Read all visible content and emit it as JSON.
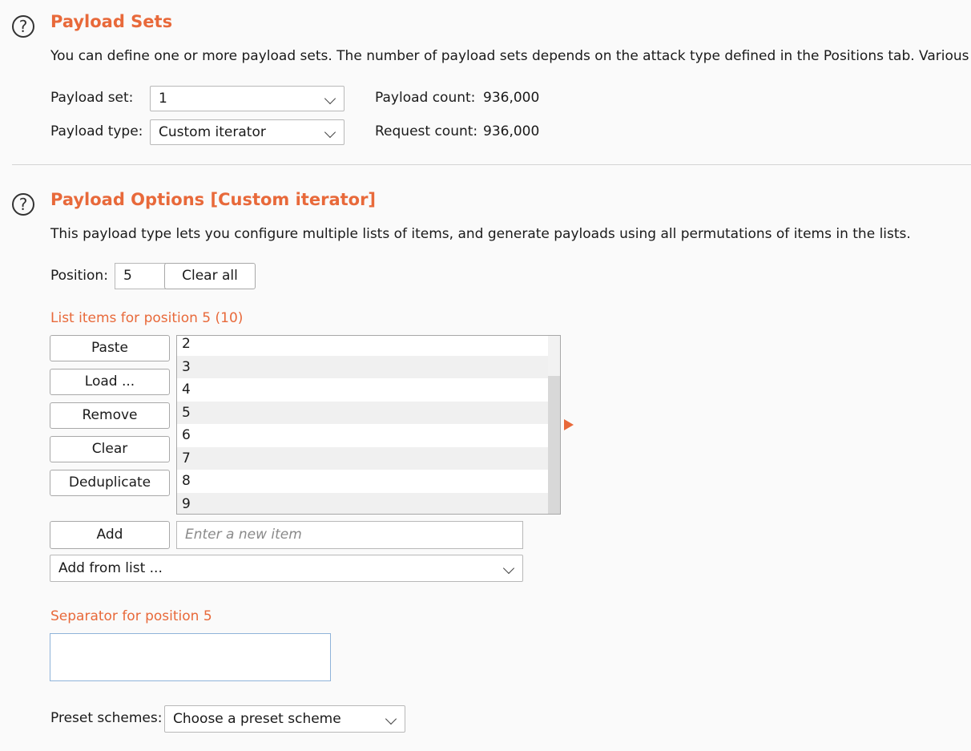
{
  "payload_sets": {
    "title": "Payload Sets",
    "description": "You can define one or more payload sets. The number of payload sets depends on the attack type defined in the Positions tab. Various",
    "payload_set_label": "Payload set:",
    "payload_set_value": "1",
    "payload_type_label": "Payload type:",
    "payload_type_value": "Custom iterator",
    "payload_count_label": "Payload count:",
    "payload_count_value": "936,000",
    "request_count_label": "Request count:",
    "request_count_value": "936,000"
  },
  "payload_options": {
    "title": "Payload Options [Custom iterator]",
    "description": "This payload type lets you configure multiple lists of items, and generate payloads using all permutations of items in the lists.",
    "position_label": "Position:",
    "position_value": "5",
    "clear_all_label": "Clear all",
    "list_heading": "List items for position 5 (10)",
    "buttons": {
      "paste": "Paste",
      "load": "Load ...",
      "remove": "Remove",
      "clear": "Clear",
      "deduplicate": "Deduplicate",
      "add": "Add"
    },
    "list_items": [
      "2",
      "3",
      "4",
      "5",
      "6",
      "7",
      "8",
      "9"
    ],
    "new_item_placeholder": "Enter a new item",
    "add_from_list_value": "Add from list ...",
    "separator_heading": "Separator for position 5",
    "separator_value": "",
    "preset_label": "Preset schemes:",
    "preset_value": "Choose a preset scheme"
  },
  "colors": {
    "accent": "#e8693a",
    "background": "#fafafa"
  }
}
